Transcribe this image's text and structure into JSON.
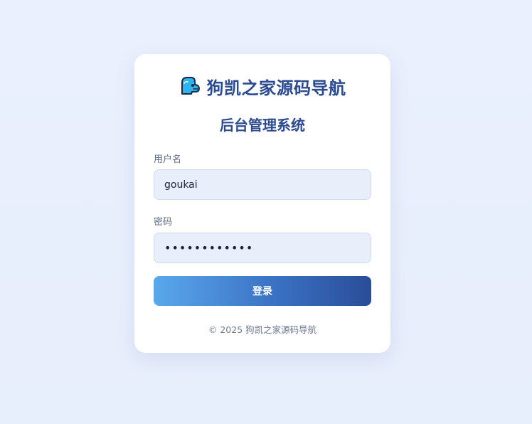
{
  "brand": {
    "title": "狗凯之家源码导航",
    "logo_icon": "dog-logo-icon"
  },
  "login": {
    "heading": "后台管理系统",
    "username_label": "用户名",
    "username_value": "goukai",
    "password_label": "密码",
    "password_value": "goukai123456",
    "submit_label": "登录"
  },
  "footer": {
    "copyright": "© 2025 狗凯之家源码导航"
  },
  "colors": {
    "background": "#e9effc",
    "brand": "#2c4a8f",
    "button_start": "#5aa8ec",
    "button_end": "#2a4d98",
    "input_bg": "#e8effb"
  }
}
